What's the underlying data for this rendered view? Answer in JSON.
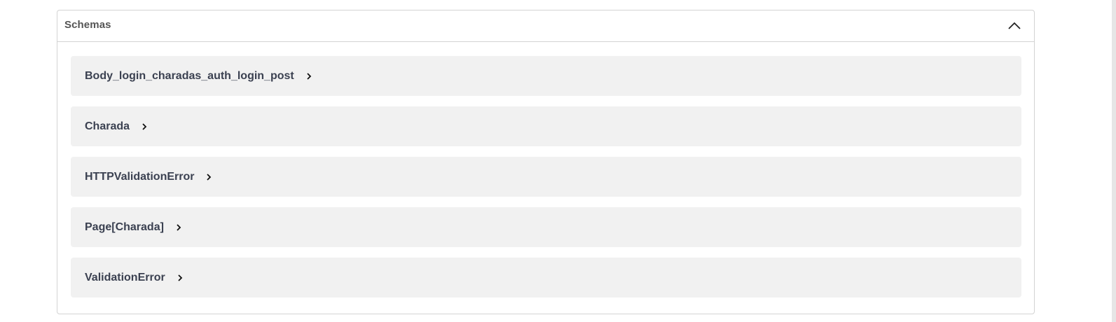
{
  "schemas": {
    "title": "Schemas",
    "toggle_icon": "chevron-up-icon",
    "items": [
      {
        "label": "Body_login_charadas_auth_login_post",
        "icon": "chevron-right-icon"
      },
      {
        "label": "Charada",
        "icon": "chevron-right-icon"
      },
      {
        "label": "HTTPValidationError",
        "icon": "chevron-right-icon"
      },
      {
        "label": "Page[Charada]",
        "icon": "chevron-right-icon"
      },
      {
        "label": "ValidationError",
        "icon": "chevron-right-icon"
      }
    ]
  },
  "colors": {
    "border": "#d3d3d3",
    "item_background": "#f1f1f1",
    "title_text": "#555555",
    "item_text": "#3b4151"
  }
}
